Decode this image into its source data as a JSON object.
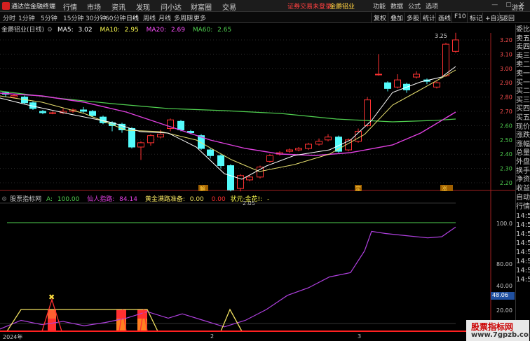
{
  "app": {
    "title": "通达信金融终端"
  },
  "menu": [
    "行情",
    "市场",
    "资讯",
    "发现",
    "问小达",
    "财富圈",
    "交易"
  ],
  "status": {
    "login_warning": "证券交易未登录",
    "stock": "金爵铝业"
  },
  "right_menu": [
    "功能",
    "数据",
    "公式",
    "选项"
  ],
  "guest": "游客",
  "periods": [
    "分时",
    "1分钟",
    "5分钟",
    "15分钟",
    "30分钟",
    "60分钟",
    "日线",
    "周线",
    "月线",
    "多周期",
    "更多"
  ],
  "toolbar_buttons": [
    "复权",
    "叠加",
    "多股",
    "统计",
    "画线",
    "F10",
    "标记",
    "+自选",
    "返回"
  ],
  "chart1": {
    "name": "金爵铝业(日线)",
    "ma5_label": "MA5:",
    "ma5": "3.02",
    "ma10_label": "MA10:",
    "ma10": "2.95",
    "ma20_label": "MA20:",
    "ma20": "2.69",
    "ma60_label": "MA60:",
    "ma60": "2.65",
    "y_labels": [
      "3.20",
      "3.10",
      "3.00",
      "2.90",
      "2.80",
      "2.70",
      "2.60",
      "2.50",
      "2.40",
      "2.30",
      "2.20"
    ],
    "high_mark": "3.25",
    "low_mark": "2.05",
    "tags": [
      "解",
      "定",
      "涨"
    ]
  },
  "chart2": {
    "name": "股票指标网",
    "a_label": "A:",
    "a_value": "100.00",
    "b_label": "仙人指路:",
    "b_value": "84.14",
    "c_label": "黄金满路准备:",
    "c_value": "0.00",
    "d_value": "0.00",
    "e_label": "状元·金花!:",
    "e_value": "-",
    "y_labels": [
      "100.0",
      "80.00",
      "40.00",
      "20.00"
    ],
    "current": "48.06"
  },
  "dates": [
    "2024年",
    "2",
    "3"
  ],
  "right_panel": [
    "委比",
    "卖五",
    "卖四",
    "卖三",
    "卖二",
    "卖一",
    "买一",
    "买二",
    "买三",
    "买四",
    "买五",
    "现价",
    "涨跌",
    "涨幅",
    "总量",
    "外盘",
    "换手",
    "净资",
    "收益",
    "自动",
    "行情",
    "14:56",
    "14:56",
    "14:56",
    "14:56",
    "14:56",
    "14:56",
    "14:56",
    "14:56"
  ],
  "watermark": {
    "line1": "股票指标网",
    "line2": "www.7gpzb.com"
  },
  "colors": {
    "up": "#ff3232",
    "down": "#54fcfc",
    "ma5": "#ffffff",
    "ma10": "#ffff50",
    "ma20": "#ff50ff",
    "ma60": "#50d050"
  }
}
